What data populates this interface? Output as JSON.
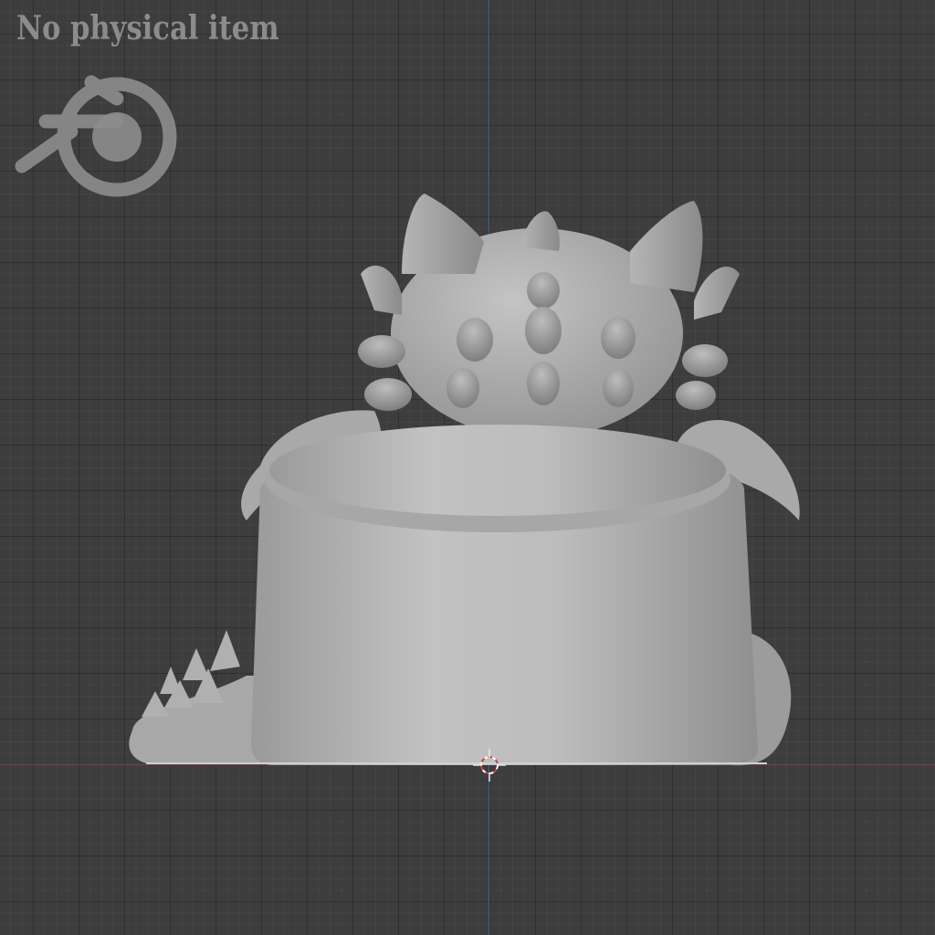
{
  "viewport": {
    "watermark_text": "No physical item",
    "colors": {
      "background": "#3d3d3d",
      "model": "#b8b8b8",
      "x_axis": "#8a3b3e",
      "z_axis": "#3e6a8f",
      "watermark": "#9a9a9a"
    },
    "icons": {
      "logo": "blender-logo-icon",
      "cursor": "3d-cursor-icon"
    }
  }
}
